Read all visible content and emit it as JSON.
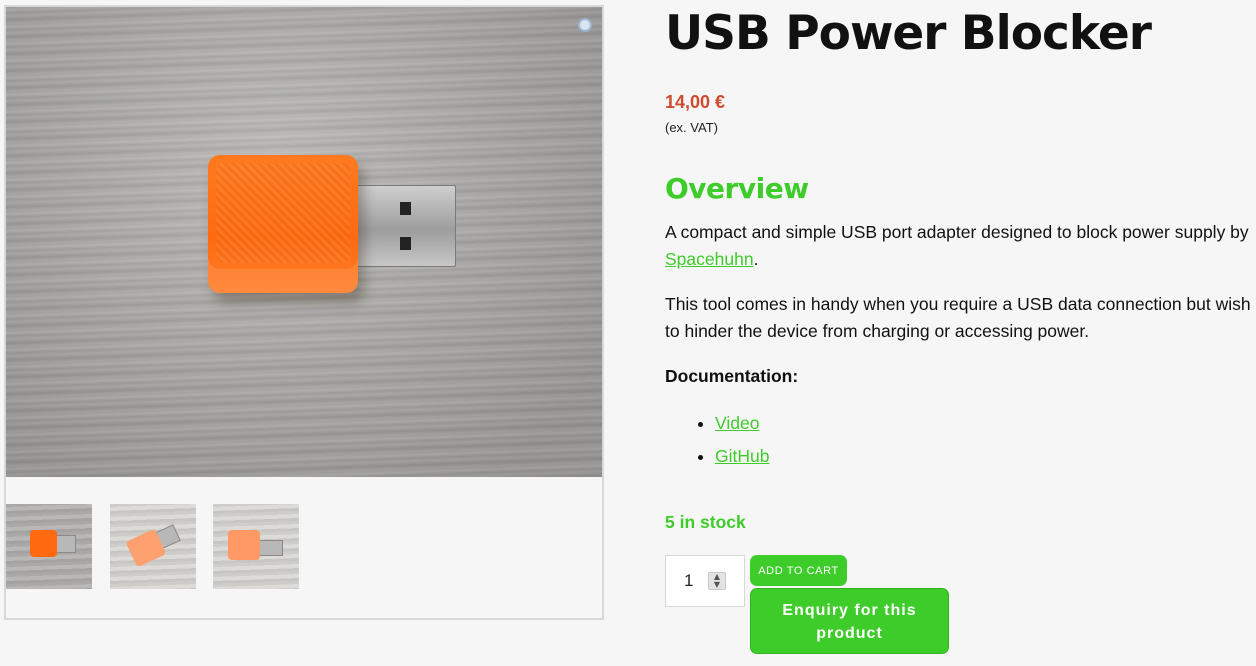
{
  "product": {
    "title": "USB Power Blocker",
    "price": "14,00 €",
    "vat_note": "(ex. VAT)",
    "stock": "5 in stock"
  },
  "overview": {
    "heading": "Overview",
    "para1_before": "A compact and simple USB port adapter designed to block power supply by ",
    "para1_link": "Spacehuhn",
    "para1_after": ".",
    "para2": "This tool comes in handy when you require a USB data connection but wish to hinder the device from charging or accessing power.",
    "doc_heading": "Documentation:",
    "doc_links": [
      "Video",
      "GitHub"
    ]
  },
  "cart": {
    "quantity": "1",
    "add_to_cart_label": "ADD TO CART",
    "enquiry_label": "Enquiry for this product"
  },
  "gallery": {
    "zoom_icon": "magnifier-icon",
    "thumbnail_count": 3
  },
  "colors": {
    "accent_green": "#3ecc2b",
    "price_red": "#d24a2e",
    "plug_orange": "#ff6a10"
  }
}
